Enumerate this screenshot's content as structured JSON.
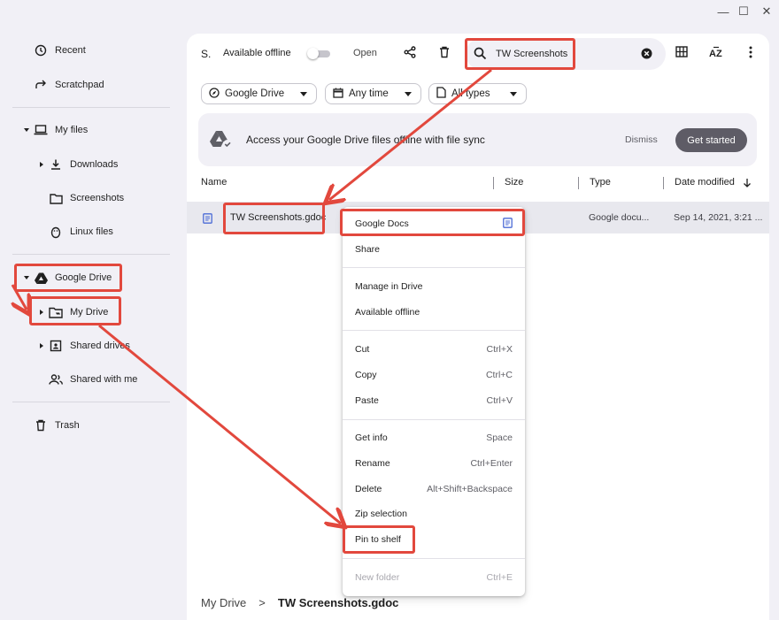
{
  "window": {
    "minimize_glyph": "—",
    "maximize_glyph": "☐",
    "close_glyph": "✕"
  },
  "sidebar": {
    "recent": "Recent",
    "scratchpad": "Scratchpad",
    "my_files": "My files",
    "downloads": "Downloads",
    "screenshots": "Screenshots",
    "linux_files": "Linux files",
    "google_drive": "Google Drive",
    "my_drive": "My Drive",
    "shared_drives": "Shared drives",
    "shared_with_me": "Shared with me",
    "trash": "Trash"
  },
  "toolbar": {
    "selection_label": "S.",
    "available_offline": "Available offline",
    "open": "Open",
    "search_query": "TW Screenshots"
  },
  "filters": {
    "location": "Google Drive",
    "time": "Any time",
    "type": "All types"
  },
  "banner": {
    "message": "Access your Google Drive files offline with file sync",
    "dismiss": "Dismiss",
    "get_started": "Get started"
  },
  "columns": {
    "name": "Name",
    "size": "Size",
    "type": "Type",
    "date_modified": "Date modified"
  },
  "file_row": {
    "name": "TW Screenshots.gdoc",
    "type": "Google docu...",
    "date": "Sep 14, 2021, 3:21 ..."
  },
  "context_menu": {
    "open_with": "Google Docs",
    "share": "Share",
    "manage_in_drive": "Manage in Drive",
    "available_offline": "Available offline",
    "cut": "Cut",
    "cut_sc": "Ctrl+X",
    "copy": "Copy",
    "copy_sc": "Ctrl+C",
    "paste": "Paste",
    "paste_sc": "Ctrl+V",
    "get_info": "Get info",
    "get_info_sc": "Space",
    "rename": "Rename",
    "rename_sc": "Ctrl+Enter",
    "delete": "Delete",
    "delete_sc": "Alt+Shift+Backspace",
    "zip_selection": "Zip selection",
    "pin_to_shelf": "Pin to shelf",
    "new_folder": "New folder",
    "new_folder_sc": "Ctrl+E"
  },
  "breadcrumb": {
    "root": "My Drive",
    "separator": ">",
    "current": "TW Screenshots.gdoc"
  },
  "colors": {
    "annotation": "#e2483d",
    "doc_icon": "#4b6bd6",
    "primary_button": "#5e5c66"
  }
}
